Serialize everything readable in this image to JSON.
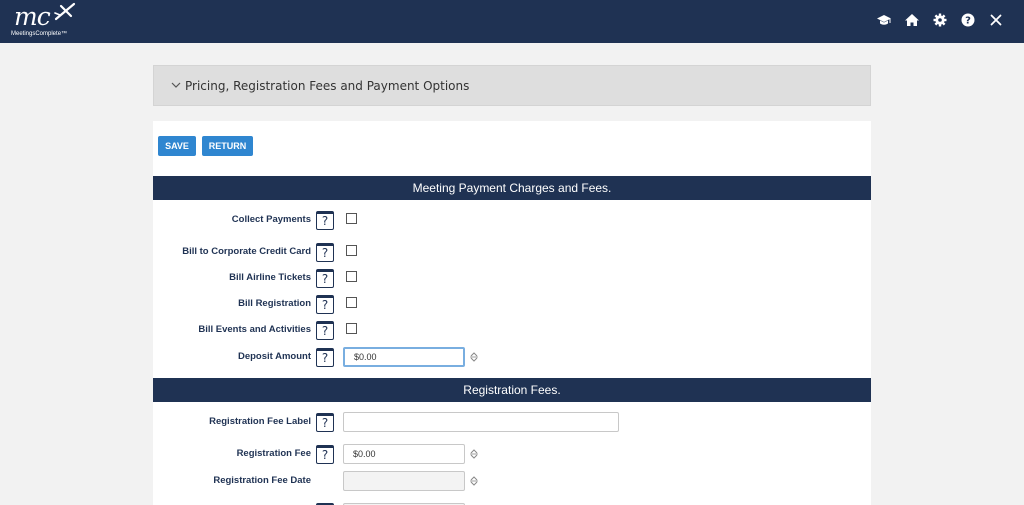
{
  "brand": {
    "logo_text": "mc",
    "logo_subtitle": "MeetingsComplete™"
  },
  "topbar": {
    "icons": [
      "graduation-cap-icon",
      "home-icon",
      "gear-icon",
      "help-icon",
      "close-icon"
    ]
  },
  "accordion": {
    "title": "Pricing, Registration Fees and Payment Options"
  },
  "toolbar": {
    "save_label": "SAVE",
    "return_label": "RETURN"
  },
  "sections": {
    "payment": {
      "title": "Meeting Payment Charges and Fees.",
      "collect_payments": {
        "label": "Collect Payments",
        "checked": false
      },
      "bill_corporate": {
        "label": "Bill to Corporate Credit Card",
        "checked": false
      },
      "bill_airline": {
        "label": "Bill Airline Tickets",
        "checked": false
      },
      "bill_registration": {
        "label": "Bill Registration",
        "checked": false
      },
      "bill_events": {
        "label": "Bill Events and Activities",
        "checked": false
      },
      "deposit_amount": {
        "label": "Deposit Amount",
        "value": "$0.00"
      }
    },
    "registration": {
      "title": "Registration Fees.",
      "fee_label": {
        "label": "Registration Fee Label",
        "value": ""
      },
      "fee": {
        "label": "Registration Fee",
        "value": "$0.00"
      },
      "fee_date": {
        "label": "Registration Fee Date",
        "value": ""
      }
    }
  },
  "help_glyph": "?",
  "colors": {
    "navy": "#1f3253",
    "button_blue": "#2f86d0",
    "page_bg": "#f2f2f2",
    "accordion_bg": "#dedede"
  }
}
